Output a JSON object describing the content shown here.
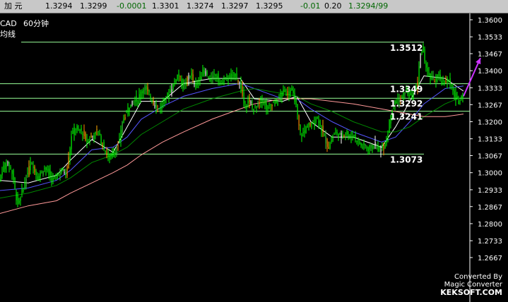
{
  "quote_bar": {
    "name": "加  元",
    "prev_close": "1.3294",
    "last": "1.3299",
    "change": "-0.0001",
    "open": "1.3301",
    "low": "1.3274",
    "high": "1.3297",
    "close": "1.3295",
    "change2": "-0.01",
    "vol": "0.20",
    "ratio": "1.3294/99"
  },
  "header": {
    "symbol": "CAD",
    "period": "60分钟",
    "type_label": "均线"
  },
  "colors": {
    "background": "#000000",
    "axis": "#ffffff",
    "candle": "#00ff00",
    "ma_fast": "#ffffff",
    "ma_mid": "#5555ff",
    "ma_slow": "#008800",
    "ma_long": "#ff9999",
    "support_line": "#99ff99",
    "arrow": "#cc33ff",
    "up_change": "#006600"
  },
  "chart_data": {
    "type": "candlestick",
    "ylim": [
      1.2725,
      1.3575
    ],
    "y_ticks": [
      "1.3600",
      "1.3533",
      "1.3467",
      "1.3400",
      "1.3333",
      "1.3267",
      "1.3200",
      "1.3133",
      "1.3067",
      "1.3000",
      "1.2933",
      "1.2867",
      "1.2800",
      "1.2733",
      "1.2667"
    ],
    "levels": [
      {
        "value": 1.3512,
        "label": "1.3512"
      },
      {
        "value": 1.3349,
        "label": "1.3349"
      },
      {
        "value": 1.3292,
        "label": "1.3292"
      },
      {
        "value": 1.3241,
        "label": "1.3241"
      },
      {
        "value": 1.3073,
        "label": "1.3073"
      }
    ],
    "price_path": [
      [
        0,
        1.296
      ],
      [
        5,
        1.301
      ],
      [
        10,
        1.304
      ],
      [
        15,
        1.303
      ],
      [
        20,
        1.299
      ],
      [
        25,
        1.29
      ],
      [
        28,
        1.287
      ],
      [
        32,
        1.292
      ],
      [
        36,
        1.295
      ],
      [
        40,
        1.299
      ],
      [
        45,
        1.304
      ],
      [
        50,
        1.302
      ],
      [
        55,
        1.298
      ],
      [
        60,
        1.3
      ],
      [
        65,
        1.302
      ],
      [
        70,
        1.3
      ],
      [
        75,
        1.297
      ],
      [
        80,
        1.298
      ],
      [
        85,
        1.3
      ],
      [
        90,
        1.301
      ],
      [
        95,
        1.3
      ],
      [
        100,
        1.307
      ],
      [
        102,
        1.313
      ],
      [
        105,
        1.316
      ],
      [
        108,
        1.318
      ],
      [
        112,
        1.316
      ],
      [
        116,
        1.317
      ],
      [
        120,
        1.315
      ],
      [
        125,
        1.312
      ],
      [
        130,
        1.314
      ],
      [
        135,
        1.315
      ],
      [
        140,
        1.317
      ],
      [
        145,
        1.312
      ],
      [
        150,
        1.309
      ],
      [
        155,
        1.306
      ],
      [
        160,
        1.307
      ],
      [
        165,
        1.309
      ],
      [
        170,
        1.311
      ],
      [
        173,
        1.316
      ],
      [
        176,
        1.321
      ],
      [
        180,
        1.323
      ],
      [
        184,
        1.326
      ],
      [
        188,
        1.327
      ],
      [
        192,
        1.329
      ],
      [
        196,
        1.328
      ],
      [
        200,
        1.331
      ],
      [
        204,
        1.333
      ],
      [
        208,
        1.333
      ],
      [
        212,
        1.331
      ],
      [
        216,
        1.329
      ],
      [
        220,
        1.327
      ],
      [
        224,
        1.326
      ],
      [
        228,
        1.325
      ],
      [
        232,
        1.327
      ],
      [
        236,
        1.329
      ],
      [
        240,
        1.331
      ],
      [
        244,
        1.333
      ],
      [
        248,
        1.335
      ],
      [
        252,
        1.338
      ],
      [
        255,
        1.339
      ],
      [
        258,
        1.336
      ],
      [
        262,
        1.333
      ],
      [
        266,
        1.336
      ],
      [
        270,
        1.339
      ],
      [
        274,
        1.337
      ],
      [
        278,
        1.334
      ],
      [
        282,
        1.336
      ],
      [
        286,
        1.338
      ],
      [
        290,
        1.34
      ],
      [
        294,
        1.339
      ],
      [
        298,
        1.336
      ],
      [
        302,
        1.337
      ],
      [
        306,
        1.339
      ],
      [
        310,
        1.337
      ],
      [
        314,
        1.335
      ],
      [
        318,
        1.336
      ],
      [
        322,
        1.337
      ],
      [
        326,
        1.338
      ],
      [
        330,
        1.337
      ],
      [
        334,
        1.339
      ],
      [
        338,
        1.337
      ],
      [
        342,
        1.334
      ],
      [
        345,
        1.33
      ],
      [
        348,
        1.326
      ],
      [
        352,
        1.328
      ],
      [
        356,
        1.327
      ],
      [
        360,
        1.325
      ],
      [
        364,
        1.326
      ],
      [
        368,
        1.327
      ],
      [
        372,
        1.329
      ],
      [
        376,
        1.327
      ],
      [
        380,
        1.325
      ],
      [
        384,
        1.326
      ],
      [
        388,
        1.328
      ],
      [
        392,
        1.327
      ],
      [
        396,
        1.329
      ],
      [
        400,
        1.331
      ],
      [
        404,
        1.332
      ],
      [
        408,
        1.331
      ],
      [
        412,
        1.333
      ],
      [
        416,
        1.331
      ],
      [
        420,
        1.328
      ],
      [
        423,
        1.322
      ],
      [
        426,
        1.316
      ],
      [
        430,
        1.315
      ],
      [
        434,
        1.317
      ],
      [
        438,
        1.319
      ],
      [
        442,
        1.318
      ],
      [
        446,
        1.32
      ],
      [
        450,
        1.322
      ],
      [
        454,
        1.32
      ],
      [
        458,
        1.316
      ],
      [
        462,
        1.313
      ],
      [
        466,
        1.31
      ],
      [
        470,
        1.312
      ],
      [
        474,
        1.315
      ],
      [
        478,
        1.316
      ],
      [
        482,
        1.314
      ],
      [
        486,
        1.315
      ],
      [
        490,
        1.316
      ],
      [
        494,
        1.315
      ],
      [
        498,
        1.314
      ],
      [
        502,
        1.315
      ],
      [
        506,
        1.313
      ],
      [
        510,
        1.312
      ],
      [
        514,
        1.31
      ],
      [
        518,
        1.311
      ],
      [
        522,
        1.309
      ],
      [
        526,
        1.31
      ],
      [
        530,
        1.311
      ],
      [
        534,
        1.31
      ],
      [
        538,
        1.309
      ],
      [
        542,
        1.31
      ],
      [
        546,
        1.311
      ],
      [
        550,
        1.314
      ],
      [
        553,
        1.32
      ],
      [
        556,
        1.325
      ],
      [
        560,
        1.327
      ],
      [
        564,
        1.329
      ],
      [
        568,
        1.328
      ],
      [
        572,
        1.33
      ],
      [
        576,
        1.332
      ],
      [
        580,
        1.331
      ],
      [
        584,
        1.329
      ],
      [
        588,
        1.331
      ],
      [
        592,
        1.333
      ],
      [
        596,
        1.344
      ],
      [
        598,
        1.349
      ],
      [
        601,
        1.347
      ],
      [
        604,
        1.343
      ],
      [
        608,
        1.338
      ],
      [
        612,
        1.337
      ],
      [
        616,
        1.336
      ],
      [
        620,
        1.338
      ],
      [
        624,
        1.337
      ],
      [
        628,
        1.335
      ],
      [
        632,
        1.336
      ],
      [
        636,
        1.337
      ],
      [
        640,
        1.334
      ],
      [
        644,
        1.331
      ],
      [
        648,
        1.328
      ],
      [
        652,
        1.329
      ],
      [
        656,
        1.331
      ]
    ],
    "moving_averages": {
      "ma_fast": [
        [
          0,
          1.297
        ],
        [
          40,
          1.296
        ],
        [
          80,
          1.299
        ],
        [
          100,
          1.305
        ],
        [
          130,
          1.313
        ],
        [
          160,
          1.308
        ],
        [
          180,
          1.318
        ],
        [
          200,
          1.328
        ],
        [
          230,
          1.328
        ],
        [
          260,
          1.335
        ],
        [
          300,
          1.337
        ],
        [
          340,
          1.337
        ],
        [
          360,
          1.329
        ],
        [
          400,
          1.328
        ],
        [
          420,
          1.33
        ],
        [
          440,
          1.32
        ],
        [
          470,
          1.314
        ],
        [
          500,
          1.314
        ],
        [
          540,
          1.31
        ],
        [
          560,
          1.318
        ],
        [
          580,
          1.328
        ],
        [
          600,
          1.338
        ],
        [
          630,
          1.337
        ],
        [
          656,
          1.332
        ]
      ],
      "ma_mid": [
        [
          0,
          1.293
        ],
        [
          40,
          1.294
        ],
        [
          80,
          1.297
        ],
        [
          100,
          1.301
        ],
        [
          130,
          1.309
        ],
        [
          160,
          1.31
        ],
        [
          180,
          1.314
        ],
        [
          200,
          1.321
        ],
        [
          230,
          1.326
        ],
        [
          260,
          1.33
        ],
        [
          300,
          1.333
        ],
        [
          340,
          1.335
        ],
        [
          360,
          1.333
        ],
        [
          400,
          1.329
        ],
        [
          420,
          1.329
        ],
        [
          440,
          1.325
        ],
        [
          470,
          1.32
        ],
        [
          500,
          1.316
        ],
        [
          540,
          1.312
        ],
        [
          560,
          1.314
        ],
        [
          580,
          1.32
        ],
        [
          600,
          1.327
        ],
        [
          630,
          1.333
        ],
        [
          656,
          1.334
        ]
      ],
      "ma_slow": [
        [
          0,
          1.29
        ],
        [
          40,
          1.292
        ],
        [
          80,
          1.295
        ],
        [
          100,
          1.298
        ],
        [
          130,
          1.304
        ],
        [
          160,
          1.307
        ],
        [
          180,
          1.31
        ],
        [
          200,
          1.315
        ],
        [
          230,
          1.32
        ],
        [
          260,
          1.325
        ],
        [
          300,
          1.329
        ],
        [
          340,
          1.332
        ],
        [
          360,
          1.333
        ],
        [
          400,
          1.331
        ],
        [
          420,
          1.33
        ],
        [
          440,
          1.327
        ],
        [
          470,
          1.324
        ],
        [
          500,
          1.32
        ],
        [
          540,
          1.316
        ],
        [
          560,
          1.316
        ],
        [
          580,
          1.318
        ],
        [
          600,
          1.322
        ],
        [
          630,
          1.327
        ],
        [
          656,
          1.33
        ]
      ],
      "ma_long": [
        [
          0,
          1.284
        ],
        [
          40,
          1.287
        ],
        [
          80,
          1.289
        ],
        [
          100,
          1.292
        ],
        [
          130,
          1.296
        ],
        [
          160,
          1.3
        ],
        [
          180,
          1.303
        ],
        [
          200,
          1.307
        ],
        [
          230,
          1.312
        ],
        [
          260,
          1.316
        ],
        [
          300,
          1.321
        ],
        [
          340,
          1.325
        ],
        [
          360,
          1.327
        ],
        [
          400,
          1.329
        ],
        [
          420,
          1.329
        ],
        [
          440,
          1.329
        ],
        [
          470,
          1.328
        ],
        [
          500,
          1.327
        ],
        [
          540,
          1.325
        ],
        [
          560,
          1.324
        ],
        [
          580,
          1.323
        ],
        [
          600,
          1.322
        ],
        [
          630,
          1.322
        ],
        [
          656,
          1.323
        ]
      ]
    },
    "arrow": {
      "from": [
        656,
        1.33
      ],
      "to": [
        680,
        1.345
      ]
    },
    "grid": false
  },
  "watermark": {
    "line1": "Converted By",
    "line2": "Magic Converter",
    "site": "KEKSOFT.COM"
  }
}
